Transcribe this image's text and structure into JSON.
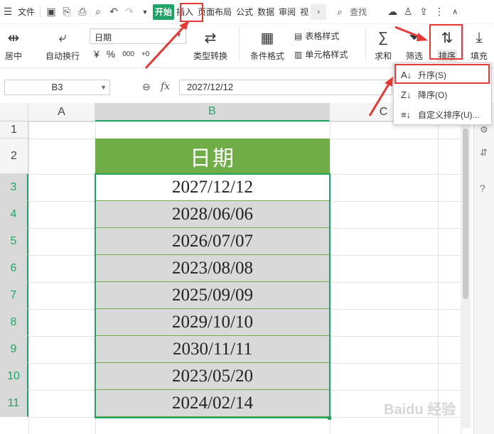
{
  "menubar": {
    "menu_label": "文件",
    "tabs": [
      "开始",
      "插入",
      "页面布局",
      "公式",
      "数据",
      "审阅",
      "视"
    ],
    "active_tab": "开始",
    "search_label": "查找"
  },
  "ribbon": {
    "merge_center": "居中",
    "wrap_text": "自动换行",
    "font_name": "日期",
    "currency_symbol": "¥",
    "percent_symbol": "%",
    "number_format_1": "000",
    "number_format_2": "+0",
    "type_convert": "类型转换",
    "conditional_format": "条件格式",
    "table_style": "表格样式",
    "cell_style": "单元格样式",
    "sum": "求和",
    "filter": "筛选",
    "sort": "排序",
    "fill": "填充"
  },
  "formula_bar": {
    "name_box": "B3",
    "fx": "fx",
    "formula": "2027/12/12"
  },
  "sheet": {
    "columns": [
      "A",
      "B",
      "C"
    ],
    "rows": [
      "1",
      "2",
      "3",
      "4",
      "5",
      "6",
      "7",
      "8",
      "9",
      "10",
      "11"
    ],
    "header_cell": "日期",
    "dates": [
      "2027/12/12",
      "2028/06/06",
      "2026/07/07",
      "2023/08/08",
      "2025/09/09",
      "2029/10/10",
      "2030/11/11",
      "2023/05/20",
      "2024/02/14"
    ]
  },
  "sort_menu": {
    "items": [
      "升序(S)",
      "降序(O)",
      "自定义排序(U)..."
    ]
  },
  "watermark": "Baidu 经验",
  "colors": {
    "accent": "#21a366",
    "header_fill": "#70ad47",
    "highlight_red": "#e53935"
  }
}
